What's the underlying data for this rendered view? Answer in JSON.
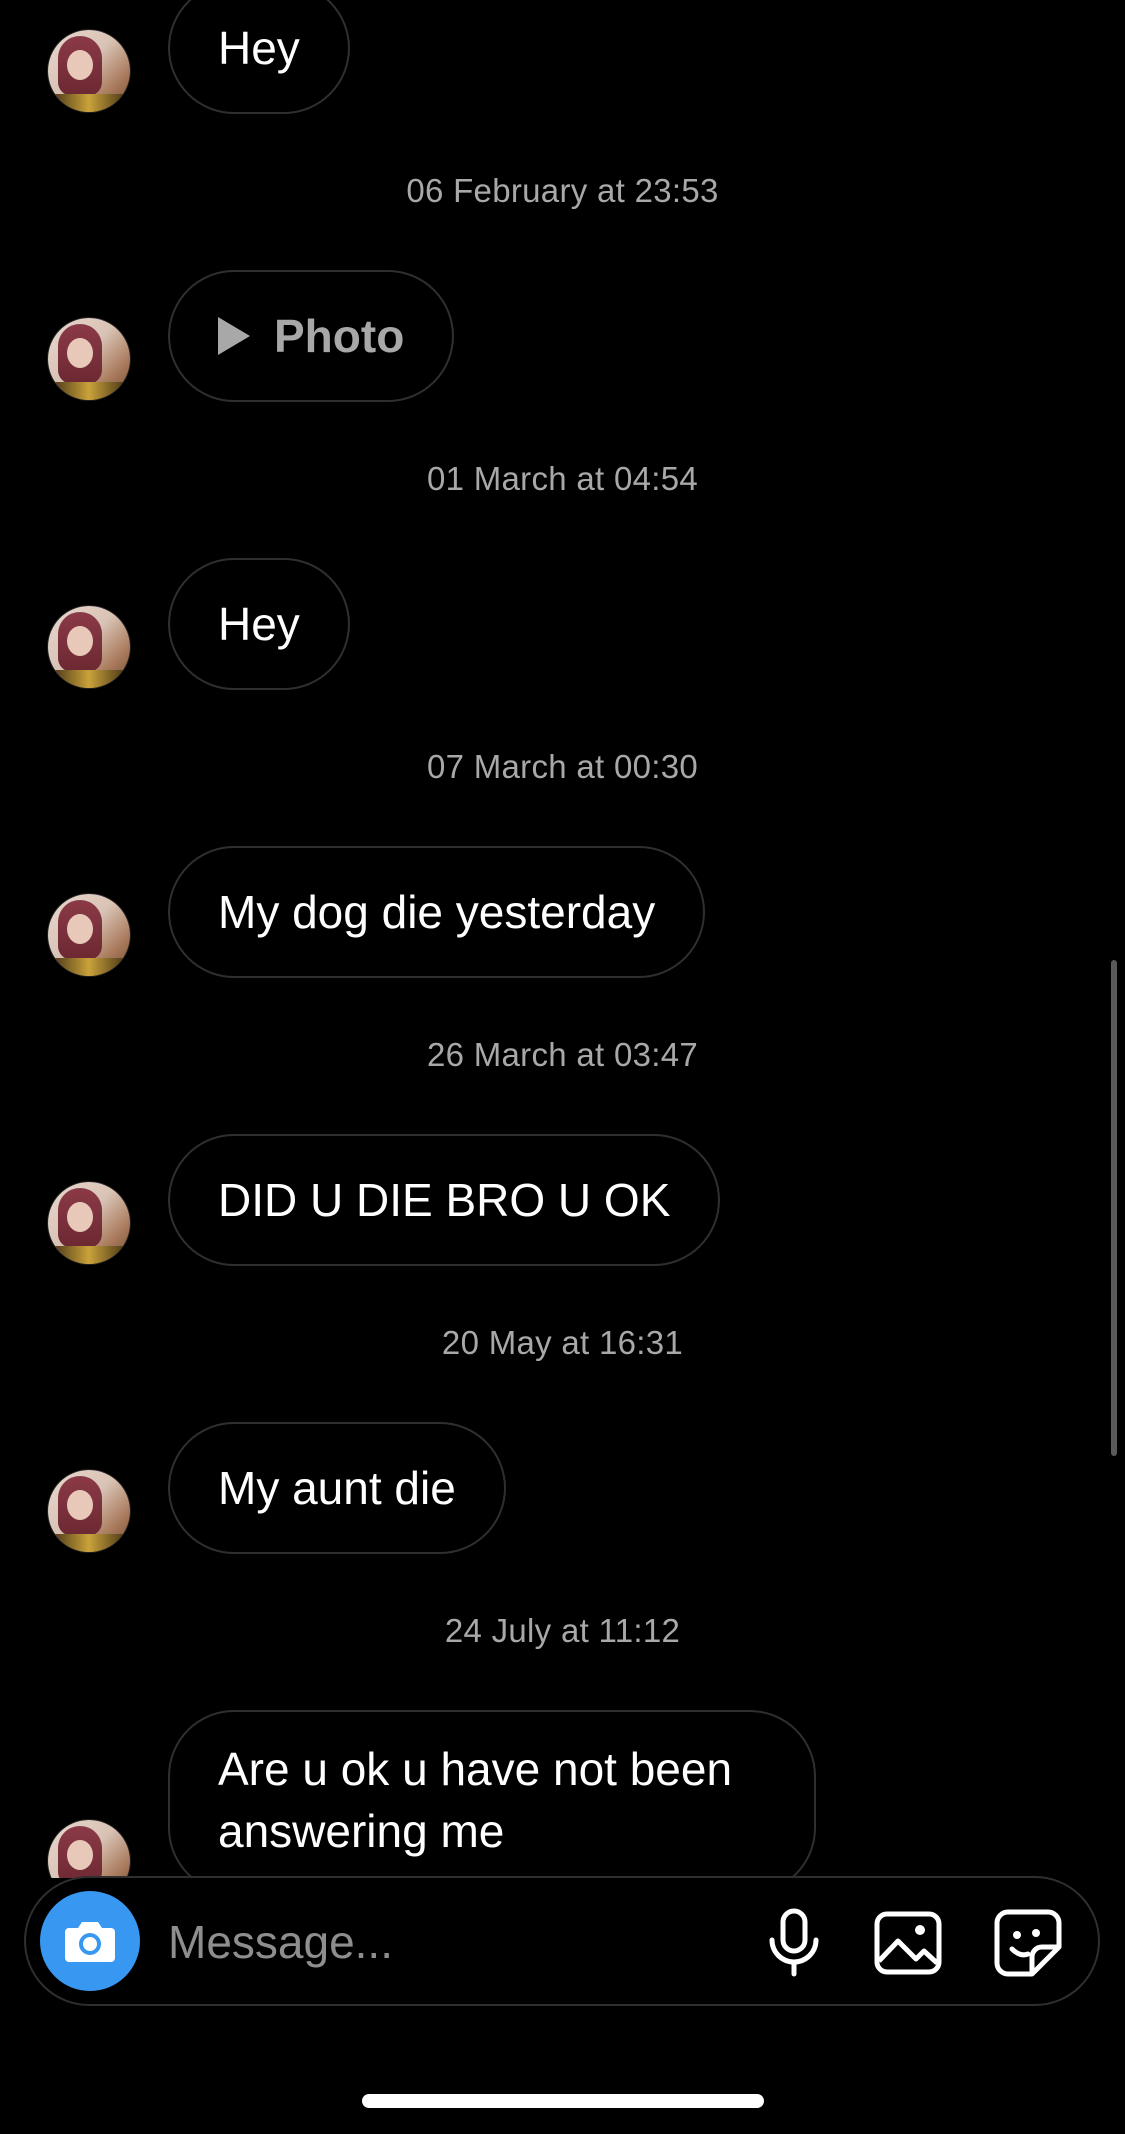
{
  "thread": {
    "messages": [
      {
        "text": "Hey"
      },
      {
        "timestamp": "06 February at 23:53",
        "text": "Photo",
        "kind": "photo"
      },
      {
        "timestamp": "01 March at 04:54",
        "text": "Hey"
      },
      {
        "timestamp": "07 March at 00:30",
        "text": "My dog die yesterday"
      },
      {
        "timestamp": "26 March at 03:47",
        "text": "DID U DIE BRO U OK"
      },
      {
        "timestamp": "20 May at 16:31",
        "text": "My aunt die"
      },
      {
        "timestamp": "24 July at 11:12",
        "text": "Are u ok u have not been answering me"
      }
    ]
  },
  "composer": {
    "placeholder": "Message...",
    "icons": [
      "camera-icon",
      "microphone-icon",
      "gallery-icon",
      "sticker-icon"
    ]
  },
  "colors": {
    "background": "#000000",
    "bubble_border": "#2f2f2f",
    "timestamp_text": "#a8a8a8",
    "camera_button": "#3897f0"
  }
}
